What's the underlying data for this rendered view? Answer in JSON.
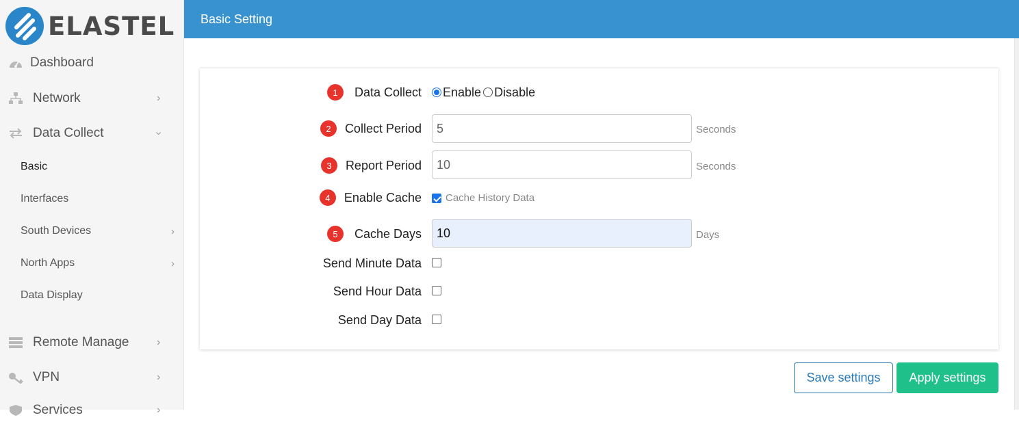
{
  "brand": {
    "name": "ELASTEL",
    "logo_color": "#2a86c8"
  },
  "sidebar": {
    "items": [
      {
        "label": "Dashboard",
        "icon": "dashboard-gauge-icon",
        "has_children": false
      },
      {
        "label": "Network",
        "icon": "network-icon",
        "has_children": true,
        "expanded": false
      },
      {
        "label": "Data Collect",
        "icon": "exchange-arrows-icon",
        "has_children": true,
        "expanded": true,
        "children": [
          {
            "label": "Basic",
            "active": true,
            "has_children": false
          },
          {
            "label": "Interfaces",
            "has_children": false
          },
          {
            "label": "South Devices",
            "has_children": true
          },
          {
            "label": "North Apps",
            "has_children": true
          },
          {
            "label": "Data Display",
            "has_children": false
          }
        ]
      },
      {
        "label": "Remote Manage",
        "icon": "server-icon",
        "has_children": true,
        "expanded": false
      },
      {
        "label": "VPN",
        "icon": "key-icon",
        "has_children": true,
        "expanded": false
      },
      {
        "label": "Services",
        "icon": "shield-icon",
        "has_children": true,
        "expanded": false
      }
    ]
  },
  "header": {
    "title": "Basic Setting",
    "color": "#3992d0"
  },
  "form": {
    "data_collect": {
      "badge": "1",
      "label": "Data Collect",
      "options": [
        "Enable",
        "Disable"
      ],
      "selected": "Enable"
    },
    "collect_period": {
      "badge": "2",
      "label": "Collect Period",
      "value": "5",
      "unit": "Seconds"
    },
    "report_period": {
      "badge": "3",
      "label": "Report Period",
      "value": "10",
      "unit": "Seconds"
    },
    "enable_cache": {
      "badge": "4",
      "label": "Enable Cache",
      "checked": true,
      "checkbox_label": "Cache History Data"
    },
    "cache_days": {
      "badge": "5",
      "label": "Cache Days",
      "value": "10",
      "unit": "Days"
    },
    "send_minute_data": {
      "label": "Send Minute Data",
      "checked": false
    },
    "send_hour_data": {
      "label": "Send Hour Data",
      "checked": false
    },
    "send_day_data": {
      "label": "Send Day Data",
      "checked": false
    }
  },
  "buttons": {
    "save": "Save settings",
    "apply": "Apply settings",
    "apply_color": "#1fc08a",
    "save_color": "#2b7ab8"
  },
  "badge_color": "#e8332d"
}
